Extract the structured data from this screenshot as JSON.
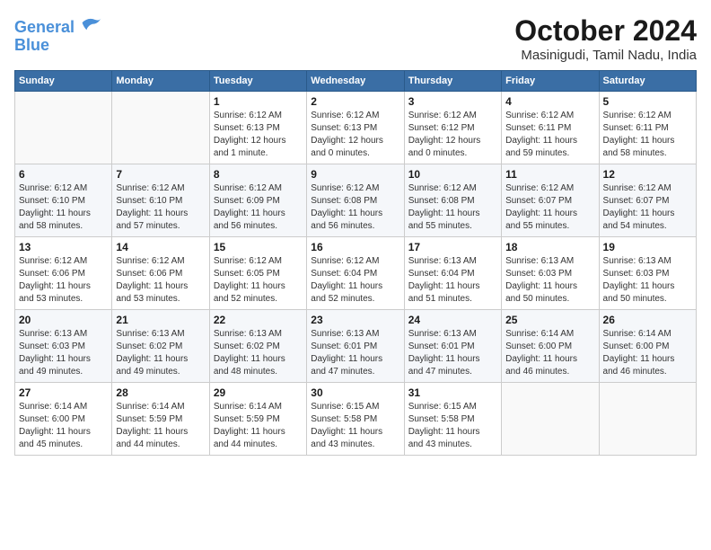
{
  "header": {
    "logo_line1": "General",
    "logo_line2": "Blue",
    "month_title": "October 2024",
    "location": "Masinigudi, Tamil Nadu, India"
  },
  "weekdays": [
    "Sunday",
    "Monday",
    "Tuesday",
    "Wednesday",
    "Thursday",
    "Friday",
    "Saturday"
  ],
  "weeks": [
    [
      {
        "day": "",
        "detail": ""
      },
      {
        "day": "",
        "detail": ""
      },
      {
        "day": "1",
        "detail": "Sunrise: 6:12 AM\nSunset: 6:13 PM\nDaylight: 12 hours\nand 1 minute."
      },
      {
        "day": "2",
        "detail": "Sunrise: 6:12 AM\nSunset: 6:13 PM\nDaylight: 12 hours\nand 0 minutes."
      },
      {
        "day": "3",
        "detail": "Sunrise: 6:12 AM\nSunset: 6:12 PM\nDaylight: 12 hours\nand 0 minutes."
      },
      {
        "day": "4",
        "detail": "Sunrise: 6:12 AM\nSunset: 6:11 PM\nDaylight: 11 hours\nand 59 minutes."
      },
      {
        "day": "5",
        "detail": "Sunrise: 6:12 AM\nSunset: 6:11 PM\nDaylight: 11 hours\nand 58 minutes."
      }
    ],
    [
      {
        "day": "6",
        "detail": "Sunrise: 6:12 AM\nSunset: 6:10 PM\nDaylight: 11 hours\nand 58 minutes."
      },
      {
        "day": "7",
        "detail": "Sunrise: 6:12 AM\nSunset: 6:10 PM\nDaylight: 11 hours\nand 57 minutes."
      },
      {
        "day": "8",
        "detail": "Sunrise: 6:12 AM\nSunset: 6:09 PM\nDaylight: 11 hours\nand 56 minutes."
      },
      {
        "day": "9",
        "detail": "Sunrise: 6:12 AM\nSunset: 6:08 PM\nDaylight: 11 hours\nand 56 minutes."
      },
      {
        "day": "10",
        "detail": "Sunrise: 6:12 AM\nSunset: 6:08 PM\nDaylight: 11 hours\nand 55 minutes."
      },
      {
        "day": "11",
        "detail": "Sunrise: 6:12 AM\nSunset: 6:07 PM\nDaylight: 11 hours\nand 55 minutes."
      },
      {
        "day": "12",
        "detail": "Sunrise: 6:12 AM\nSunset: 6:07 PM\nDaylight: 11 hours\nand 54 minutes."
      }
    ],
    [
      {
        "day": "13",
        "detail": "Sunrise: 6:12 AM\nSunset: 6:06 PM\nDaylight: 11 hours\nand 53 minutes."
      },
      {
        "day": "14",
        "detail": "Sunrise: 6:12 AM\nSunset: 6:06 PM\nDaylight: 11 hours\nand 53 minutes."
      },
      {
        "day": "15",
        "detail": "Sunrise: 6:12 AM\nSunset: 6:05 PM\nDaylight: 11 hours\nand 52 minutes."
      },
      {
        "day": "16",
        "detail": "Sunrise: 6:12 AM\nSunset: 6:04 PM\nDaylight: 11 hours\nand 52 minutes."
      },
      {
        "day": "17",
        "detail": "Sunrise: 6:13 AM\nSunset: 6:04 PM\nDaylight: 11 hours\nand 51 minutes."
      },
      {
        "day": "18",
        "detail": "Sunrise: 6:13 AM\nSunset: 6:03 PM\nDaylight: 11 hours\nand 50 minutes."
      },
      {
        "day": "19",
        "detail": "Sunrise: 6:13 AM\nSunset: 6:03 PM\nDaylight: 11 hours\nand 50 minutes."
      }
    ],
    [
      {
        "day": "20",
        "detail": "Sunrise: 6:13 AM\nSunset: 6:03 PM\nDaylight: 11 hours\nand 49 minutes."
      },
      {
        "day": "21",
        "detail": "Sunrise: 6:13 AM\nSunset: 6:02 PM\nDaylight: 11 hours\nand 49 minutes."
      },
      {
        "day": "22",
        "detail": "Sunrise: 6:13 AM\nSunset: 6:02 PM\nDaylight: 11 hours\nand 48 minutes."
      },
      {
        "day": "23",
        "detail": "Sunrise: 6:13 AM\nSunset: 6:01 PM\nDaylight: 11 hours\nand 47 minutes."
      },
      {
        "day": "24",
        "detail": "Sunrise: 6:13 AM\nSunset: 6:01 PM\nDaylight: 11 hours\nand 47 minutes."
      },
      {
        "day": "25",
        "detail": "Sunrise: 6:14 AM\nSunset: 6:00 PM\nDaylight: 11 hours\nand 46 minutes."
      },
      {
        "day": "26",
        "detail": "Sunrise: 6:14 AM\nSunset: 6:00 PM\nDaylight: 11 hours\nand 46 minutes."
      }
    ],
    [
      {
        "day": "27",
        "detail": "Sunrise: 6:14 AM\nSunset: 6:00 PM\nDaylight: 11 hours\nand 45 minutes."
      },
      {
        "day": "28",
        "detail": "Sunrise: 6:14 AM\nSunset: 5:59 PM\nDaylight: 11 hours\nand 44 minutes."
      },
      {
        "day": "29",
        "detail": "Sunrise: 6:14 AM\nSunset: 5:59 PM\nDaylight: 11 hours\nand 44 minutes."
      },
      {
        "day": "30",
        "detail": "Sunrise: 6:15 AM\nSunset: 5:58 PM\nDaylight: 11 hours\nand 43 minutes."
      },
      {
        "day": "31",
        "detail": "Sunrise: 6:15 AM\nSunset: 5:58 PM\nDaylight: 11 hours\nand 43 minutes."
      },
      {
        "day": "",
        "detail": ""
      },
      {
        "day": "",
        "detail": ""
      }
    ]
  ]
}
